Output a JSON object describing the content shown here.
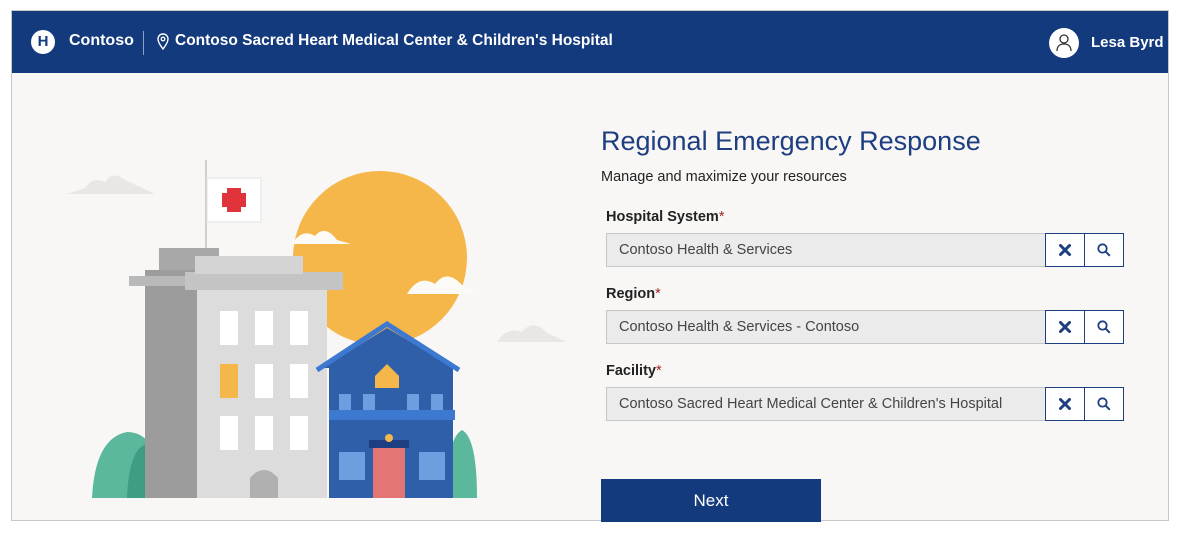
{
  "header": {
    "logo_letter": "H",
    "brand": "Contoso",
    "facility_title": "Contoso Sacred Heart Medical Center & Children's Hospital",
    "user_name": "Lesa Byrd"
  },
  "main": {
    "heading": "Regional Emergency Response",
    "subheading": "Manage and maximize your resources",
    "fields": [
      {
        "label": "Hospital System",
        "required_mark": "*",
        "value": "Contoso Health & Services"
      },
      {
        "label": "Region",
        "required_mark": "*",
        "value": "Contoso Health & Services  - Contoso"
      },
      {
        "label": "Facility",
        "required_mark": "*",
        "value": "Contoso Sacred Heart Medical Center & Children's Hospital"
      }
    ],
    "next_label": "Next"
  },
  "colors": {
    "brand_blue": "#133a7c",
    "heading_blue": "#1d3e80",
    "required_red": "#a4262c",
    "sun_orange": "#f6b74a"
  },
  "icons": [
    "logo-icon",
    "location-pin-icon",
    "user-avatar-icon",
    "clear-icon",
    "search-icon"
  ]
}
